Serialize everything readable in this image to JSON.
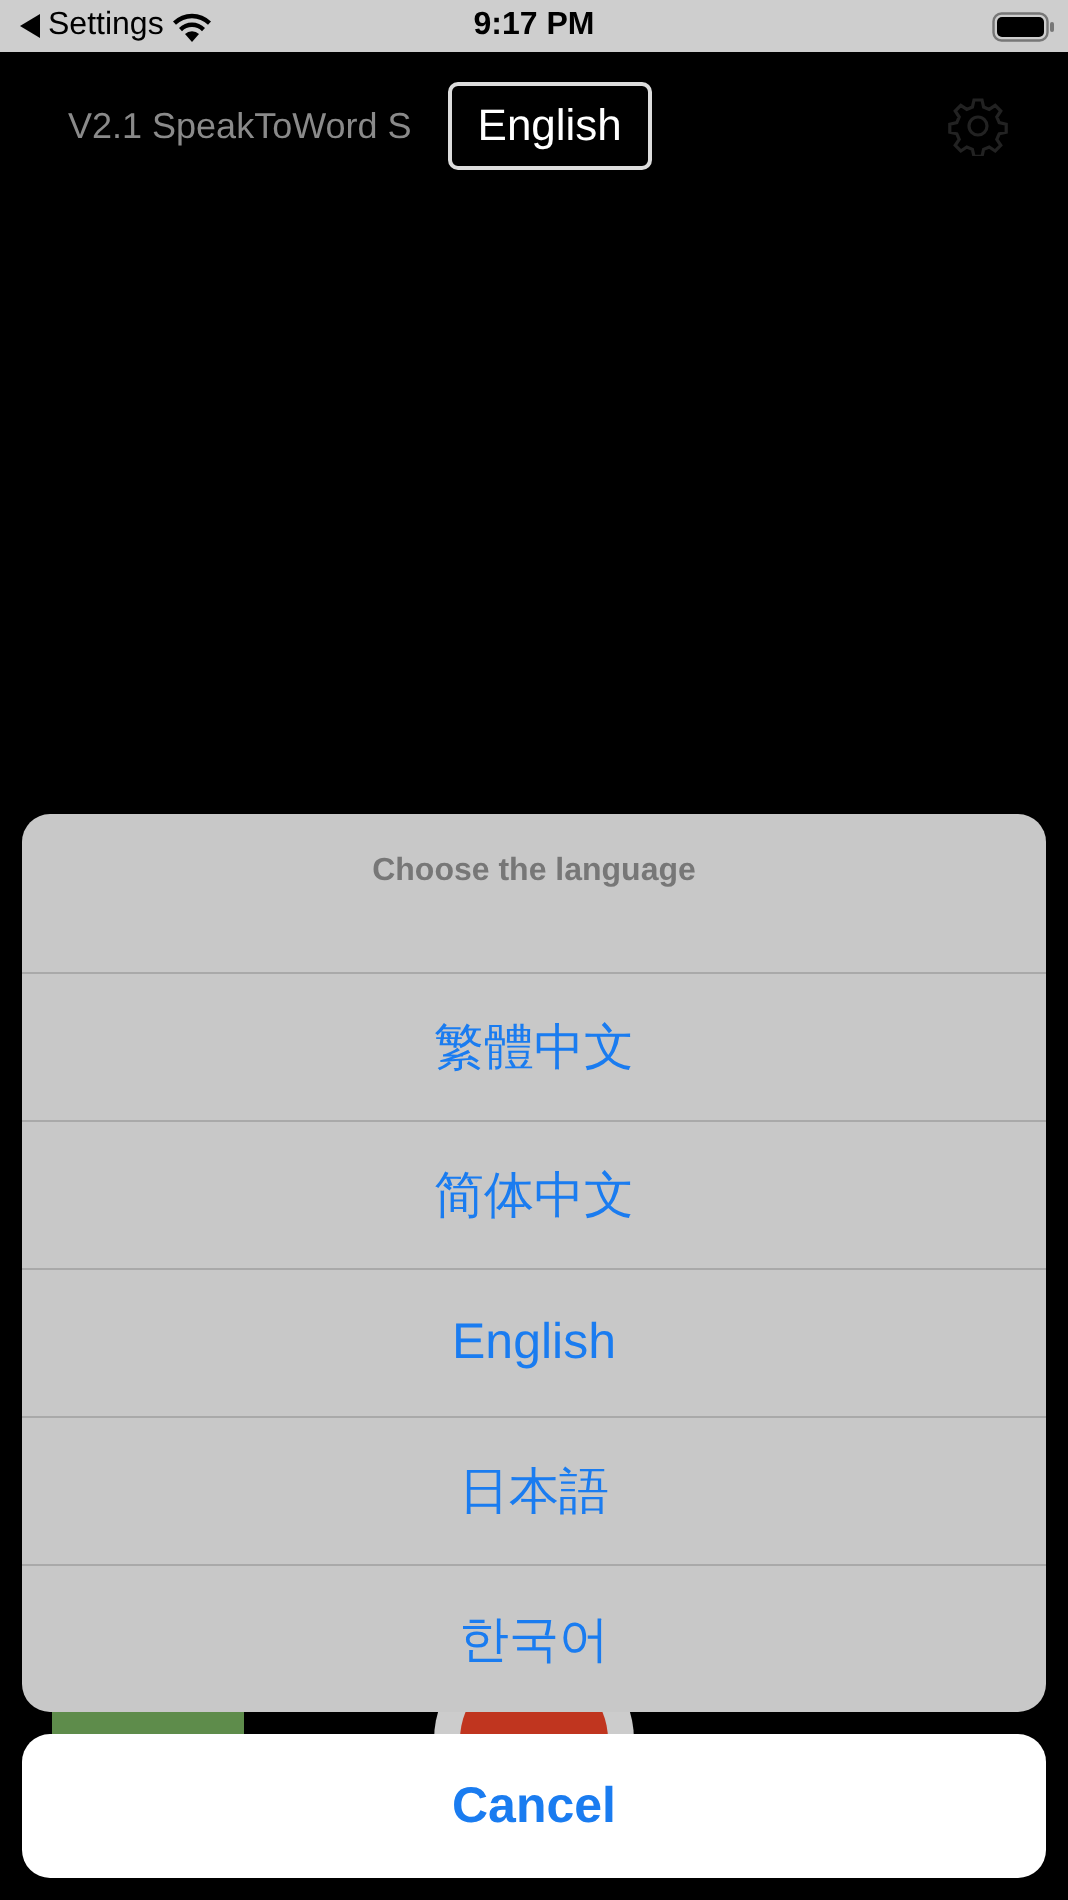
{
  "status_bar": {
    "back_label": "Settings",
    "time": "9:17 PM"
  },
  "header": {
    "title": "V2.1 SpeakToWord S",
    "language_button": "English"
  },
  "action_sheet": {
    "title": "Choose the language",
    "options": [
      {
        "label": "繁體中文"
      },
      {
        "label": "简体中文"
      },
      {
        "label": "English"
      },
      {
        "label": "日本語"
      },
      {
        "label": "한국어"
      }
    ],
    "cancel": "Cancel"
  }
}
